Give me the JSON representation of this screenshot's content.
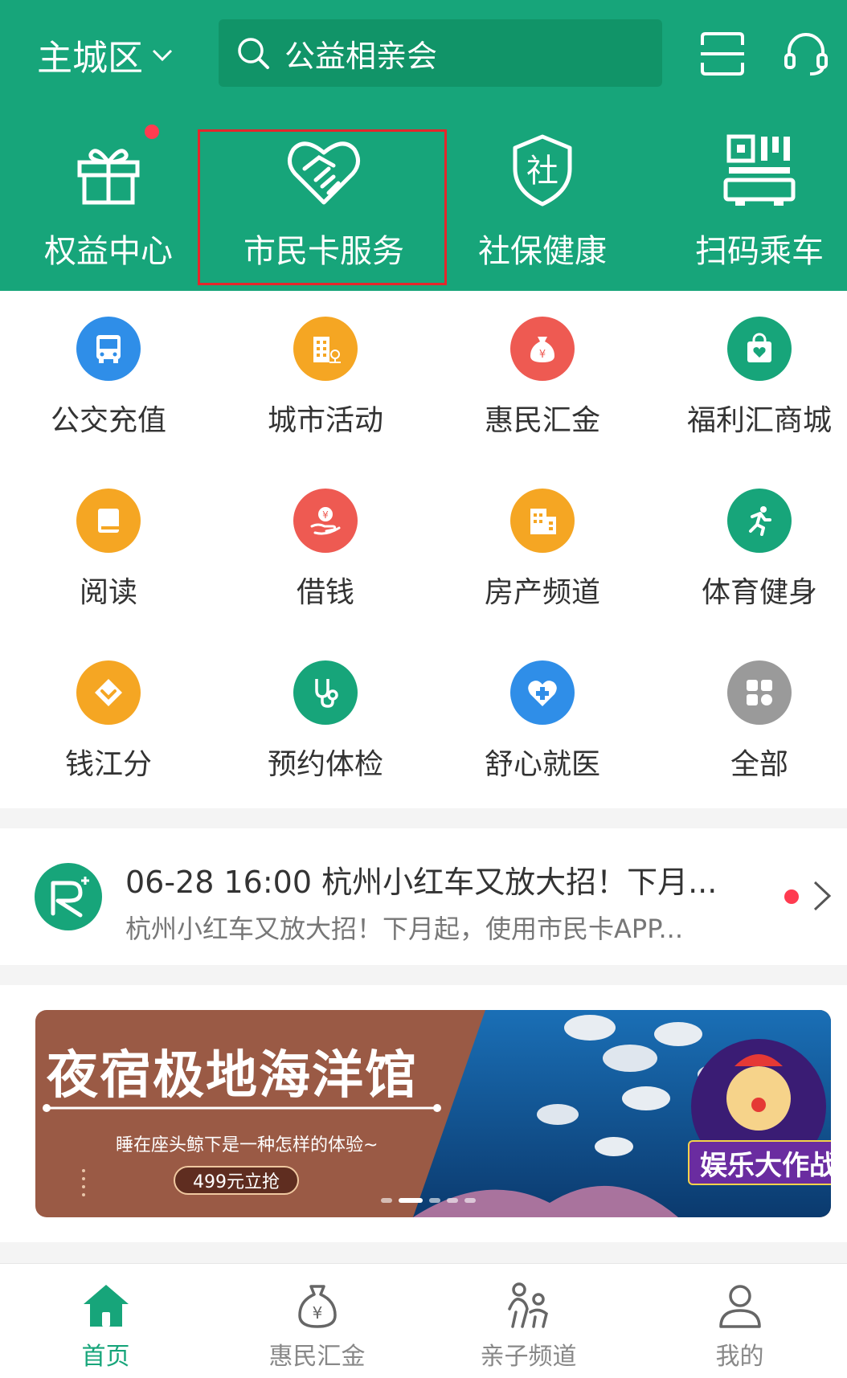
{
  "header": {
    "city": "主城区",
    "search_placeholder": "公益相亲会",
    "quick_actions": [
      {
        "label": "权益中心",
        "icon": "gift-icon"
      },
      {
        "label": "市民卡服务",
        "icon": "handshake-heart-icon"
      },
      {
        "label": "社保健康",
        "icon": "shield-icon"
      },
      {
        "label": "扫码乘车",
        "icon": "qr-scan-icon"
      }
    ]
  },
  "services": [
    {
      "label": "公交充值",
      "icon": "bus-icon",
      "color": "#2f8ee8"
    },
    {
      "label": "城市活动",
      "icon": "building-icon",
      "color": "#f5a623"
    },
    {
      "label": "惠民汇金",
      "icon": "money-bag-icon",
      "color": "#ee5a52"
    },
    {
      "label": "福利汇商城",
      "icon": "shopping-bag-icon",
      "color": "#17a57a"
    },
    {
      "label": "阅读",
      "icon": "book-icon",
      "color": "#f5a623"
    },
    {
      "label": "借钱",
      "icon": "loan-hand-icon",
      "color": "#ee5a52"
    },
    {
      "label": "房产频道",
      "icon": "buildings-icon",
      "color": "#f5a623"
    },
    {
      "label": "体育健身",
      "icon": "running-icon",
      "color": "#17a57a"
    },
    {
      "label": "钱江分",
      "icon": "diamond-icon",
      "color": "#f5a623"
    },
    {
      "label": "预约体检",
      "icon": "stethoscope-icon",
      "color": "#17a57a"
    },
    {
      "label": "舒心就医",
      "icon": "medical-heart-icon",
      "color": "#2f8ee8"
    },
    {
      "label": "全部",
      "icon": "grid-icon",
      "color": "#9a9a9a"
    }
  ],
  "notice": {
    "title": "06-28 16:00  杭州小红车又放大招！下月...",
    "subtitle": "杭州小红车又放大招！下月起，使用市民卡APP..."
  },
  "banner": {
    "title": "夜宿极地海洋馆",
    "subtitle": "睡在座头鲸下是一种怎样的体验~",
    "button": "499元立抢",
    "badge": "娱乐大作战"
  },
  "bottom_nav": [
    {
      "label": "首页",
      "icon": "home-icon",
      "active": true
    },
    {
      "label": "惠民汇金",
      "icon": "money-bag-icon",
      "active": false
    },
    {
      "label": "亲子频道",
      "icon": "family-icon",
      "active": false
    },
    {
      "label": "我的",
      "icon": "user-icon",
      "active": false
    }
  ],
  "colors": {
    "primary": "#17a57a",
    "search_bg": "#119468",
    "highlight": "#e5262b",
    "dot": "#ff3b50"
  }
}
